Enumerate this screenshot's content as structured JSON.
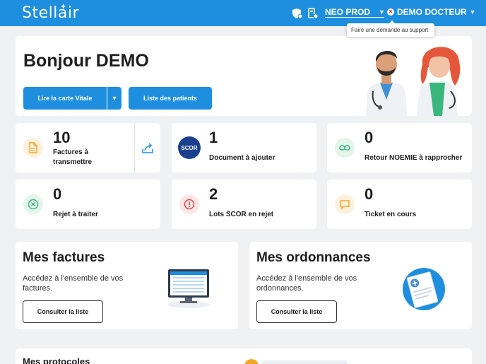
{
  "header": {
    "logo": "Stellair",
    "environment": "NEO PROD",
    "user": "DEMO DOCTEUR",
    "tooltip": "Faire une demande au support",
    "icons": [
      "shield-icon",
      "device-icon"
    ]
  },
  "welcome": {
    "greeting": "Bonjour DEMO",
    "vitale_button": "Lire la carte Vitale",
    "patients_button": "Liste des patients"
  },
  "stats": [
    {
      "count": "10",
      "label": "Factures à transmettre",
      "icon": "document-icon"
    },
    {
      "count": "1",
      "label": "Document à ajouter",
      "icon": "scor-logo"
    },
    {
      "count": "0",
      "label": "Retour NOEMIE à rapprocher",
      "icon": "link-icon"
    },
    {
      "count": "0",
      "label": "Rejet à traiter",
      "icon": "cross-circle-icon"
    },
    {
      "count": "2",
      "label": "Lots SCOR en rejet",
      "icon": "alert-icon"
    },
    {
      "count": "0",
      "label": "Ticket en cours",
      "icon": "chat-icon"
    }
  ],
  "scor_text": "SCOR",
  "features": [
    {
      "title": "Mes factures",
      "desc": "Accédez à l'ensemble de vos factures.",
      "button": "Consulter la liste"
    },
    {
      "title": "Mes ordonnances",
      "desc": "Accédez à l'ensemble de vos ordonnances.",
      "button": "Consulter la liste"
    }
  ],
  "protocols_title": "Mes protocoles",
  "colors": {
    "primary": "#1d8fde",
    "orange": "#f5a524",
    "green": "#3bb77e",
    "red": "#e04848"
  }
}
